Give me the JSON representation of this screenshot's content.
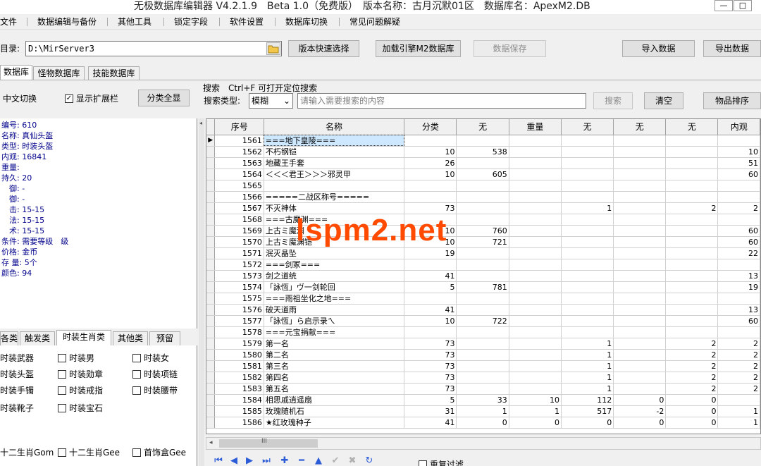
{
  "window": {
    "title": "无极数据库编辑器 V4.2.1.9　Beta 1.0（免费版）　版本名称：古月沉默01区　数据库名：ApexM2.DB",
    "minimize": "—",
    "maximize": "□"
  },
  "menu": [
    "文件",
    "数据编辑与备份",
    "其他工具",
    "锁定字段",
    "软件设置",
    "数据库切换",
    "常见问题解疑"
  ],
  "toolbar": {
    "dir_label": "目录:",
    "dir_value": "D:\\MirServer3",
    "folder_icon": "folder-icon",
    "version_select": "版本快速选择",
    "load_db": "加载引擎M2数据库",
    "save_data": "数据保存",
    "import_data": "导入数据",
    "export_data": "导出数据"
  },
  "db_tabs": [
    "数据库",
    "怪物数据库",
    "技能数据库"
  ],
  "search_bar": {
    "lang_switch": "中文切换",
    "show_ext": "显示扩展栏",
    "show_ext_checked": true,
    "show_all": "分类全显",
    "search_title": "搜索　Ctrl+F 可打开定位搜索",
    "search_type_label": "搜索类型:",
    "search_type_value": "模糊",
    "search_placeholder": "请输入需要搜索的内容",
    "search_button": "搜索",
    "clear_button": "清空",
    "sort_button": "物品排序"
  },
  "item_info": [
    "编号: 610",
    "名称: 真仙头盔",
    "类型: 时装头盔",
    "内观: 16841",
    "重量:",
    "持久: 20",
    "　御: -",
    "　御: -",
    "　击: 15-15",
    "　法: 15-15",
    "　术: 15-15",
    "条件: 需要等级　级",
    "价格: 金币",
    "存 量: 5个",
    "颜色: 94"
  ],
  "category_tabs": [
    "各类",
    "触发类",
    "时装生肖类",
    "其他类",
    "预留"
  ],
  "category_checks": [
    [
      "时装武器",
      "时装男",
      "时装女"
    ],
    [
      "时装头盔",
      "时装勋章",
      "时装项链"
    ],
    [
      "时装手镯",
      "时装戒指",
      "时装腰带"
    ],
    [
      "时装靴子",
      "时装宝石",
      ""
    ],
    [
      "十二生肖Gom",
      "十二生肖Gee",
      "首饰盒Gee"
    ]
  ],
  "grid": {
    "columns": [
      "序号",
      "名称",
      "分类",
      "无",
      "重量",
      "无",
      "无",
      "无",
      "内观"
    ],
    "rows": [
      [
        "1561",
        "===地下皇陵===",
        "",
        "",
        "",
        "",
        "",
        "",
        ""
      ],
      [
        "1562",
        "不朽钢铠",
        "10",
        "538",
        "",
        "",
        "",
        "",
        "10"
      ],
      [
        "1563",
        "地藏王手套",
        "26",
        "",
        "",
        "",
        "",
        "",
        "51"
      ],
      [
        "1564",
        "＜＜＜君王＞＞＞邪灵甲",
        "10",
        "605",
        "",
        "",
        "",
        "",
        "60"
      ],
      [
        "1565",
        "",
        "",
        "",
        "",
        "",
        "",
        "",
        ""
      ],
      [
        "1566",
        "=====二战区称号=====",
        "",
        "",
        "",
        "",
        "",
        "",
        ""
      ],
      [
        "1567",
        "不灭神体",
        "73",
        "",
        "",
        "1",
        "",
        "2",
        "2"
      ],
      [
        "1568",
        "===古魔渊===",
        "",
        "",
        "",
        "",
        "",
        "",
        ""
      ],
      [
        "1569",
        "上古ミ魔渊",
        "10",
        "760",
        "",
        "",
        "",
        "",
        "60"
      ],
      [
        "1570",
        "上古ミ魔渊铠",
        "10",
        "721",
        "",
        "",
        "",
        "",
        "60"
      ],
      [
        "1571",
        "泯灭晶坠",
        "19",
        "",
        "",
        "",
        "",
        "",
        "22"
      ],
      [
        "1572",
        "===剑冢===",
        "",
        "",
        "",
        "",
        "",
        "",
        ""
      ],
      [
        "1573",
        "剑之道统",
        "41",
        "",
        "",
        "",
        "",
        "",
        "13"
      ],
      [
        "1574",
        "「詠恆」ヴ一剑轮回",
        "5",
        "781",
        "",
        "",
        "",
        "",
        "19"
      ],
      [
        "1575",
        "===雨祖坐化之地===",
        "",
        "",
        "",
        "",
        "",
        "",
        ""
      ],
      [
        "1576",
        "破天道雨",
        "41",
        "",
        "",
        "",
        "",
        "",
        "13"
      ],
      [
        "1577",
        "「詠恆」ら启示录ㄟ",
        "10",
        "722",
        "",
        "",
        "",
        "",
        "60"
      ],
      [
        "1578",
        "===元宝捐献===",
        "",
        "",
        "",
        "",
        "",
        "",
        ""
      ],
      [
        "1579",
        "第一名",
        "73",
        "",
        "",
        "1",
        "",
        "2",
        "2"
      ],
      [
        "1580",
        "第二名",
        "73",
        "",
        "",
        "1",
        "",
        "2",
        "2"
      ],
      [
        "1581",
        "第三名",
        "73",
        "",
        "",
        "1",
        "",
        "2",
        "2"
      ],
      [
        "1582",
        "第四名",
        "73",
        "",
        "",
        "1",
        "",
        "2",
        "2"
      ],
      [
        "1583",
        "第五名",
        "73",
        "",
        "",
        "1",
        "",
        "2",
        "2"
      ],
      [
        "1584",
        "相思戚逍遥扇",
        "5",
        "33",
        "10",
        "112",
        "0",
        "0",
        ""
      ],
      [
        "1585",
        "玫瑰随机石",
        "31",
        "1",
        "1",
        "517",
        "-2",
        "0",
        "1"
      ],
      [
        "1586",
        "★红玫瑰种子",
        "41",
        "0",
        "0",
        "0",
        "0",
        "0",
        "1"
      ]
    ],
    "selected_index": 0
  },
  "scroll_label": "III",
  "watermark": "lspm2.net",
  "bottom": {
    "dup_filter": "重复过滤"
  }
}
